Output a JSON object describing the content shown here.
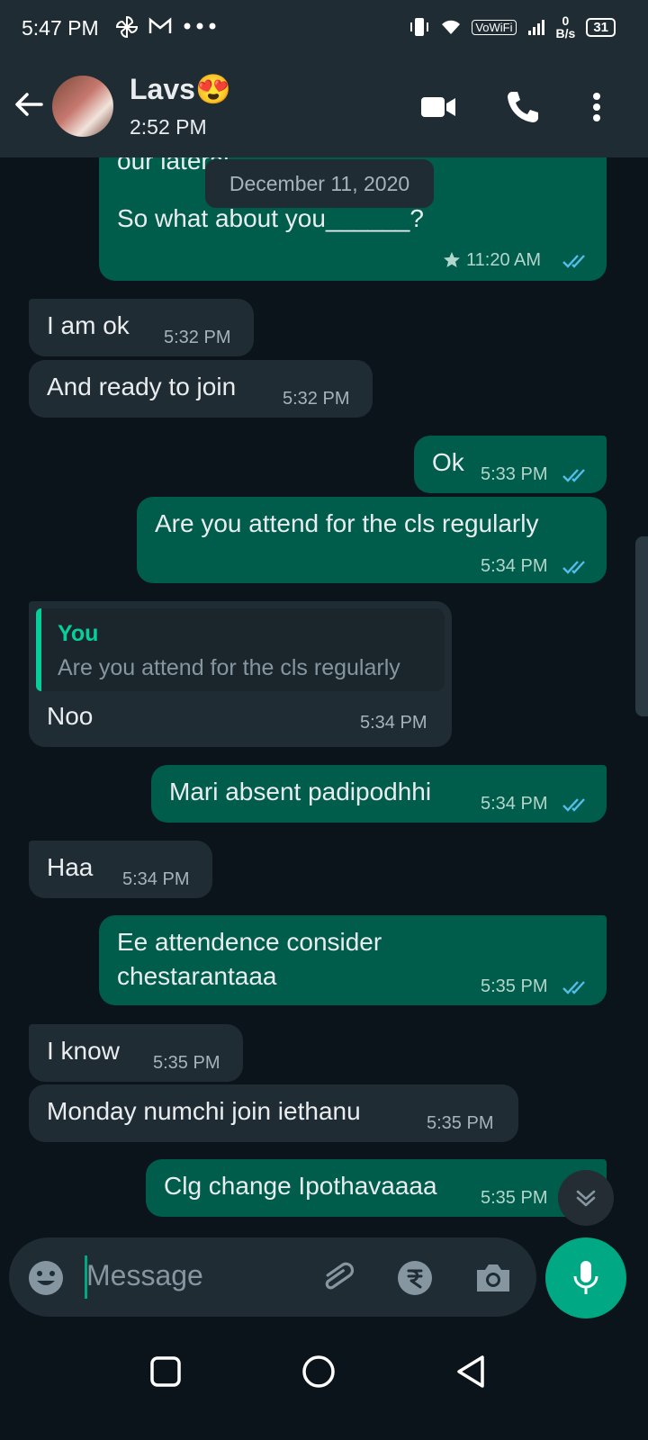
{
  "status_bar": {
    "time": "5:47 PM",
    "net_speed_value": "0",
    "net_speed_unit": "B/s",
    "battery": "31",
    "wifi_label": "VoWiFi",
    "icons": [
      "pinwheel-icon",
      "gmail-icon",
      "more-dots-icon",
      "vibrate-icon",
      "wifi-icon",
      "signal-icon"
    ]
  },
  "header": {
    "contact_name": "Lavs😍",
    "last_seen": "2:52 PM",
    "actions": [
      "video-call-icon",
      "phone-icon",
      "menu-icon"
    ]
  },
  "date_chip": "December 11, 2020",
  "messages": [
    {
      "dir": "out",
      "text": "So what about you______?",
      "time": "11:20 AM",
      "starred": true,
      "partial_top_text": "our lateral ... "
    },
    {
      "dir": "in",
      "text": "I am ok",
      "time": "5:32 PM"
    },
    {
      "dir": "in",
      "text": "And ready to join",
      "time": "5:32 PM"
    },
    {
      "dir": "out",
      "text": "Ok",
      "time": "5:33 PM"
    },
    {
      "dir": "out",
      "text": "Are you attend for the cls regularly",
      "time": "5:34 PM"
    },
    {
      "dir": "in",
      "text": "Noo",
      "time": "5:34 PM",
      "reply": {
        "author": "You",
        "text": "Are you attend for the cls regularly"
      }
    },
    {
      "dir": "out",
      "text": "Mari absent padipodhhi",
      "time": "5:34 PM"
    },
    {
      "dir": "in",
      "text": "Haa",
      "time": "5:34 PM"
    },
    {
      "dir": "out",
      "text_line1": "Ee attendence consider",
      "text_line2": "chestarantaaa",
      "time": "5:35 PM"
    },
    {
      "dir": "in",
      "text": "I know",
      "time": "5:35 PM"
    },
    {
      "dir": "in",
      "text": "Monday numchi join iethanu",
      "time": "5:35 PM"
    },
    {
      "dir": "out",
      "text": "Clg change Ipothavaaaa",
      "time": "5:35 PM"
    }
  ],
  "composer": {
    "placeholder": "Message",
    "icons": [
      "emoji-icon",
      "attach-icon",
      "rupee-icon",
      "camera-icon",
      "mic-icon"
    ]
  },
  "colors": {
    "bg": "#0b141a",
    "header": "#1f2c34",
    "incoming": "#202c33",
    "outgoing": "#005c4b",
    "accent": "#00a884",
    "tick": "#53bdeb"
  }
}
